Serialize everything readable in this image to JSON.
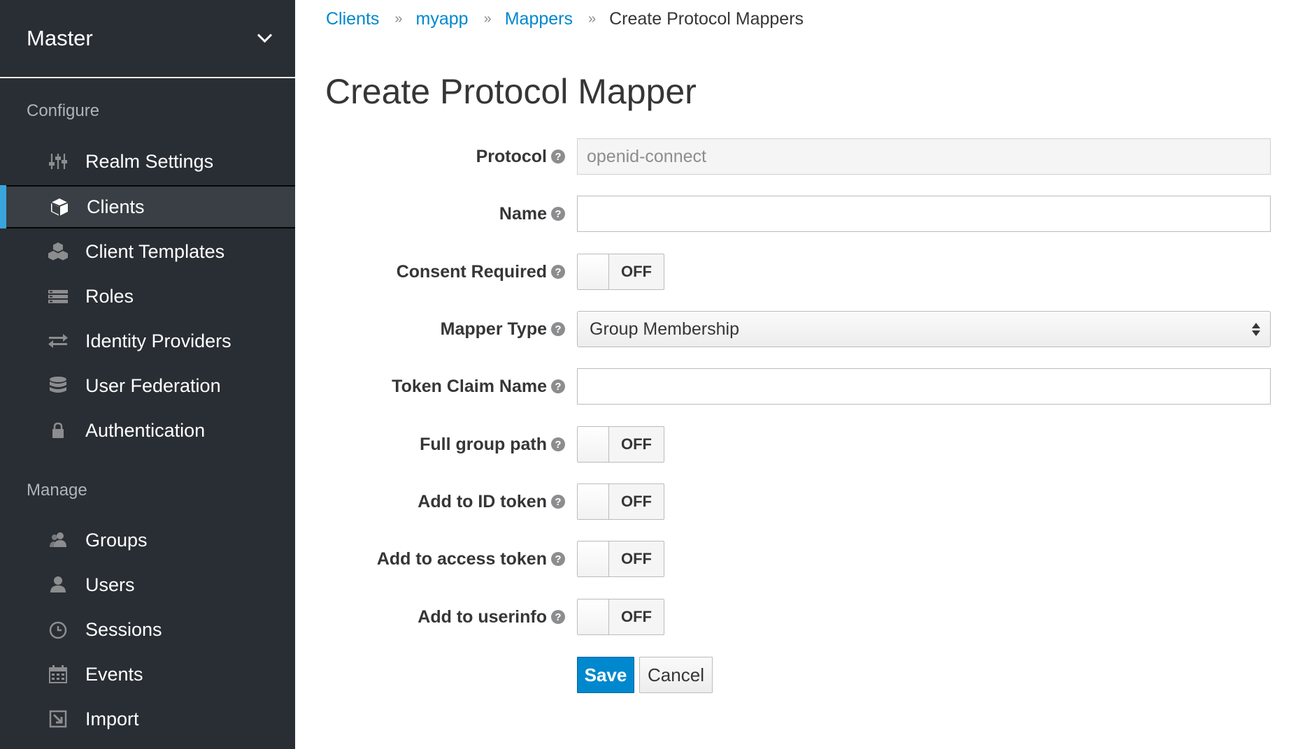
{
  "sidebar": {
    "realm": "Master",
    "configure_label": "Configure",
    "manage_label": "Manage",
    "configure_items": [
      {
        "label": "Realm Settings",
        "icon": "sliders-icon"
      },
      {
        "label": "Clients",
        "icon": "cube-icon",
        "active": true
      },
      {
        "label": "Client Templates",
        "icon": "cubes-icon"
      },
      {
        "label": "Roles",
        "icon": "list-icon"
      },
      {
        "label": "Identity Providers",
        "icon": "exchange-icon"
      },
      {
        "label": "User Federation",
        "icon": "database-icon"
      },
      {
        "label": "Authentication",
        "icon": "lock-icon"
      }
    ],
    "manage_items": [
      {
        "label": "Groups",
        "icon": "users-icon"
      },
      {
        "label": "Users",
        "icon": "user-icon"
      },
      {
        "label": "Sessions",
        "icon": "clock-icon"
      },
      {
        "label": "Events",
        "icon": "calendar-icon"
      },
      {
        "label": "Import",
        "icon": "import-icon"
      }
    ]
  },
  "breadcrumb": {
    "items": [
      "Clients",
      "myapp",
      "Mappers"
    ],
    "separator": "»",
    "current": "Create Protocol Mappers"
  },
  "page_title": "Create Protocol Mapper",
  "form": {
    "protocol": {
      "label": "Protocol",
      "value": "openid-connect"
    },
    "name": {
      "label": "Name",
      "value": ""
    },
    "consent_required": {
      "label": "Consent Required",
      "state": "OFF"
    },
    "mapper_type": {
      "label": "Mapper Type",
      "value": "Group Membership"
    },
    "token_claim_name": {
      "label": "Token Claim Name",
      "value": ""
    },
    "full_group_path": {
      "label": "Full group path",
      "state": "OFF"
    },
    "add_to_id_token": {
      "label": "Add to ID token",
      "state": "OFF"
    },
    "add_to_access_token": {
      "label": "Add to access token",
      "state": "OFF"
    },
    "add_to_userinfo": {
      "label": "Add to userinfo",
      "state": "OFF"
    },
    "help_glyph": "?"
  },
  "buttons": {
    "save": "Save",
    "cancel": "Cancel"
  },
  "colors": {
    "sidebar_bg": "#292e34",
    "active_bg": "#393f44",
    "accent": "#39a5dc",
    "link": "#0088ce",
    "primary_button": "#0088ce"
  }
}
